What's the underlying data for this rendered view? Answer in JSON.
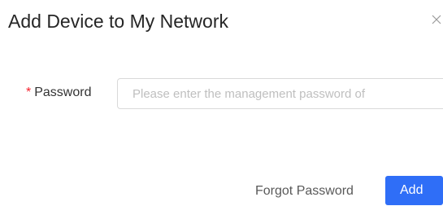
{
  "dialog": {
    "title": "Add Device to My Network",
    "close_icon": "close-icon"
  },
  "form": {
    "password": {
      "required_mark": "*",
      "label": "Password",
      "value": "",
      "placeholder": "Please enter the management password of"
    }
  },
  "footer": {
    "forgot_password_label": "Forgot Password",
    "add_label": "Add"
  },
  "colors": {
    "accent": "#2f6ef7",
    "required": "#f5222d",
    "border": "#d9d9d9",
    "placeholder": "#bfbfbf"
  }
}
